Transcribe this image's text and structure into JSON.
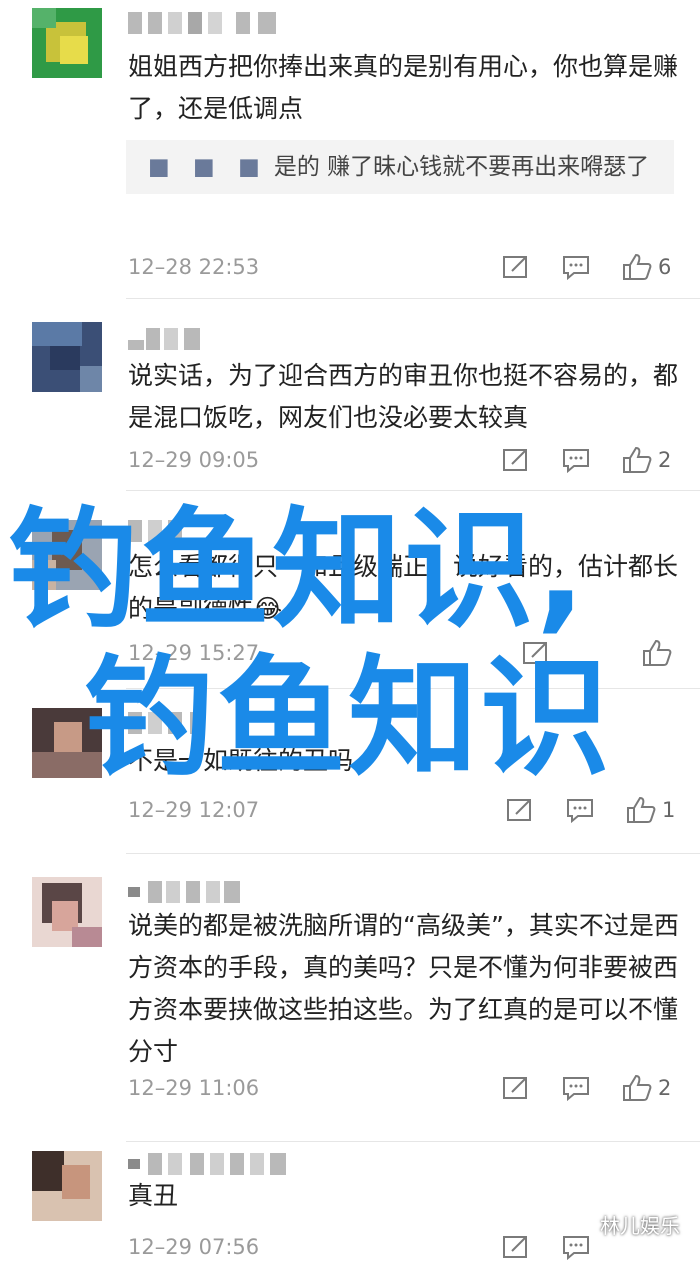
{
  "comments": [
    {
      "text": "姐姐西方把你捧出来真的是别有用心，你也算是赚了，还是低调点",
      "quote": {
        "dots": "■ ■ ■",
        "text": "是的 赚了昧心钱就不要再出来嘚瑟了"
      },
      "time": "12–28 22:53",
      "likes": "6"
    },
    {
      "text": "说实话，为了迎合西方的审丑你也挺不容易的，都是混口饭吃，网友们也没必要太较真",
      "time": "12–29 09:05",
      "likes": "2"
    },
    {
      "text": "怎么看都得只一和且级端正，说好看的，估计都长的是副德性😂",
      "time": "12–29 15:27",
      "likes": ""
    },
    {
      "text": "不是一如既往的丑吗",
      "time": "12–29 12:07",
      "likes": "1"
    },
    {
      "text": "说美的都是被洗脑所谓的“高级美”，其实不过是西方资本的手段，真的美吗？只是不懂为何非要被西方资本要挟做这些拍这些。为了红真的是可以不懂分寸",
      "time": "12–29 11:06",
      "likes": "2"
    },
    {
      "text": "真丑",
      "time": "12–29 07:56",
      "likes": ""
    }
  ],
  "overlay": {
    "line1": "钓鱼知识,",
    "line2": "钓鱼知识"
  },
  "watermark": "林儿娱乐",
  "colors": {
    "overlay": "#1a8ae8",
    "time": "#9a9a9a",
    "quote_bg": "#f3f3f3"
  },
  "icons": [
    "share-icon",
    "reply-icon",
    "thumbs-up-icon"
  ]
}
